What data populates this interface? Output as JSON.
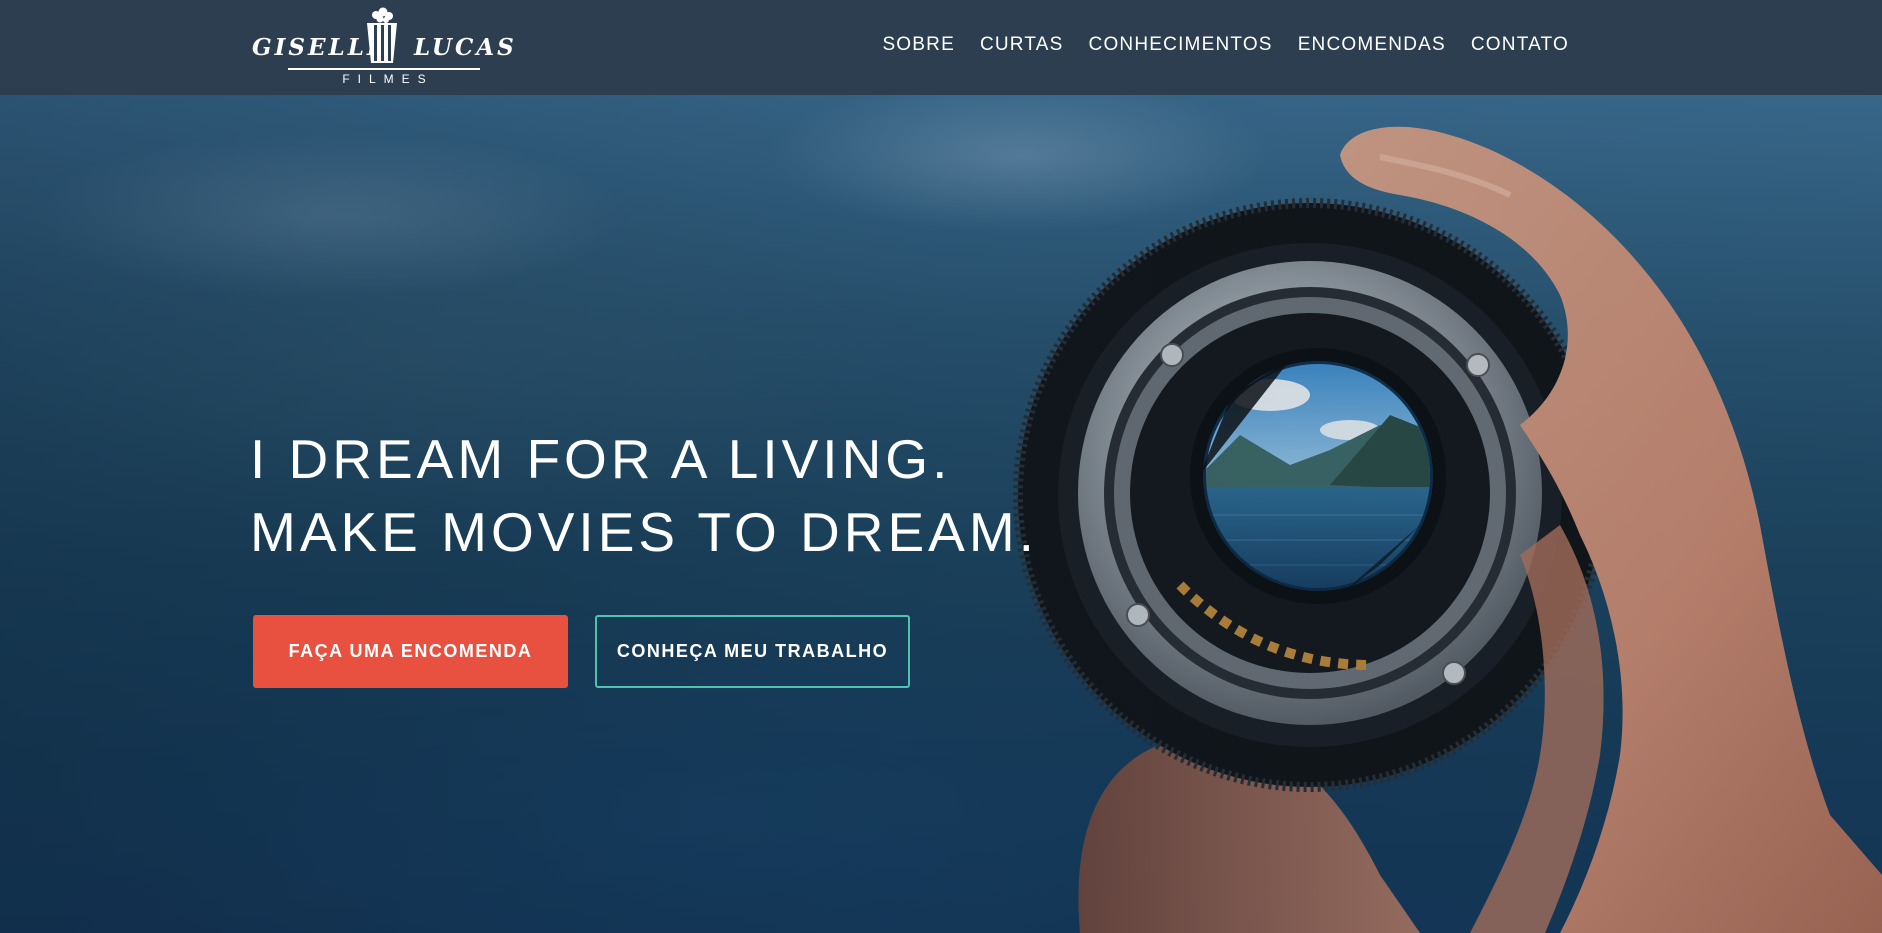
{
  "brand": {
    "name_left": "GISELLE",
    "name_right": "LUCAS",
    "subtitle": "FILMES",
    "logo_icon": "popcorn-box-icon"
  },
  "nav": {
    "items": [
      "SOBRE",
      "CURTAS",
      "CONHECIMENTOS",
      "ENCOMENDAS",
      "CONTATO"
    ]
  },
  "hero": {
    "headline_line1": "I DREAM FOR A LIVING.",
    "headline_line2": "MAKE MOVIES TO DREAM.",
    "primary_button": "FAÇA UMA ENCOMENDA",
    "secondary_button": "CONHEÇA MEU TRABALHO",
    "image": "hand-holding-camera-lens-over-lake"
  },
  "colors": {
    "header_bg": "#2d3e50",
    "primary_button": "#e8503f",
    "secondary_button_border": "#4fc3b0",
    "text": "#ffffff"
  }
}
